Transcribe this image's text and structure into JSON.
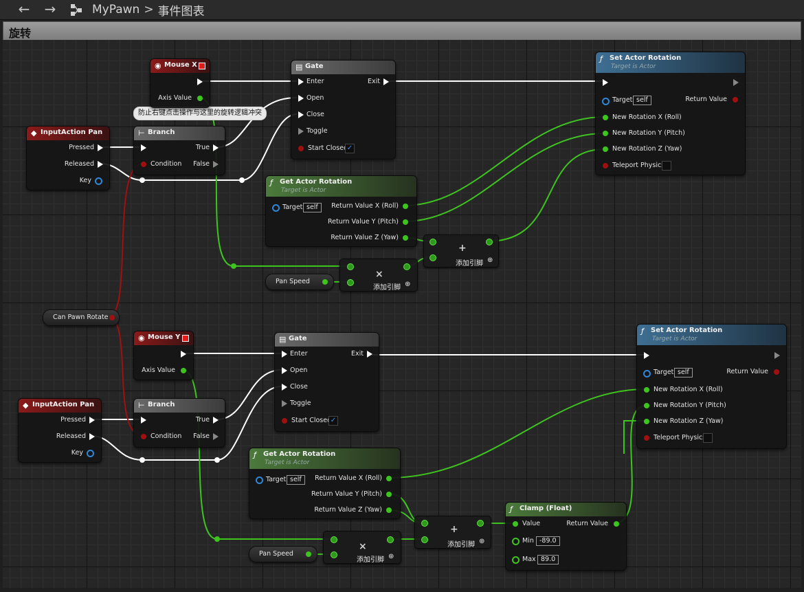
{
  "topbar": {
    "back_icon": "back-arrow-icon",
    "forward_icon": "forward-arrow-icon",
    "crumb_app": "MyPawn",
    "crumb_sep": ">",
    "crumb_page": "事件图表"
  },
  "graph_title": "旋转",
  "comment_tip": "防止右键点击操作与这里的旋转逻辑冲突",
  "mouse_x": {
    "title": "Mouse X",
    "pin": "Axis Value"
  },
  "mouse_y": {
    "title": "Mouse Y",
    "pin": "Axis Value"
  },
  "input_pan_1": {
    "title": "InputAction Pan",
    "pressed": "Pressed",
    "released": "Released",
    "key": "Key"
  },
  "input_pan_2": {
    "title": "InputAction Pan",
    "pressed": "Pressed",
    "released": "Released",
    "key": "Key"
  },
  "branch_1": {
    "title": "Branch",
    "condition": "Condition",
    "true": "True",
    "false": "False"
  },
  "branch_2": {
    "title": "Branch",
    "condition": "Condition",
    "true": "True",
    "false": "False"
  },
  "gate_1": {
    "title": "Gate",
    "enter": "Enter",
    "exit": "Exit",
    "open": "Open",
    "close": "Close",
    "toggle": "Toggle",
    "start_closed": "Start Closed",
    "start_closed_checked": true
  },
  "gate_2": {
    "title": "Gate",
    "enter": "Enter",
    "exit": "Exit",
    "open": "Open",
    "close": "Close",
    "toggle": "Toggle",
    "start_closed": "Start Closed",
    "start_closed_checked": true
  },
  "get_rot_1": {
    "title": "Get Actor Rotation",
    "subtitle": "Target is Actor",
    "target": "Target",
    "self": "self",
    "rx": "Return Value X (Roll)",
    "ry": "Return Value Y (Pitch)",
    "rz": "Return Value Z (Yaw)"
  },
  "get_rot_2": {
    "title": "Get Actor Rotation",
    "subtitle": "Target is Actor",
    "target": "Target",
    "self": "self",
    "rx": "Return Value X (Roll)",
    "ry": "Return Value Y (Pitch)",
    "rz": "Return Value Z (Yaw)"
  },
  "set_rot_1": {
    "title": "Set Actor Rotation",
    "subtitle": "Target is Actor",
    "target": "Target",
    "self": "self",
    "ret": "Return Value",
    "nx": "New Rotation X (Roll)",
    "ny": "New Rotation Y (Pitch)",
    "nz": "New Rotation Z (Yaw)",
    "tp": "Teleport Physics"
  },
  "set_rot_2": {
    "title": "Set Actor Rotation",
    "subtitle": "Target is Actor",
    "target": "Target",
    "self": "self",
    "ret": "Return Value",
    "nx": "New Rotation X (Roll)",
    "ny": "New Rotation Y (Pitch)",
    "nz": "New Rotation Z (Yaw)",
    "tp": "Teleport Physics"
  },
  "mult_1": {
    "symbol": "×",
    "add_pin": "添加引脚"
  },
  "mult_2": {
    "symbol": "×",
    "add_pin": "添加引脚"
  },
  "add_1": {
    "symbol": "+",
    "add_pin": "添加引脚"
  },
  "add_2": {
    "symbol": "+",
    "add_pin": "添加引脚"
  },
  "pan_speed_1": "Pan Speed",
  "pan_speed_2": "Pan Speed",
  "can_rotate": "Can Pawn Rotate",
  "clamp": {
    "title": "Clamp (Float)",
    "value": "Value",
    "ret": "Return Value",
    "min": "Min",
    "max": "Max",
    "min_val": "-89.0",
    "max_val": "89.0"
  },
  "colors": {
    "exec_wire": "#ffffff",
    "float_wire": "#3ec41e",
    "bool_wire": "#a01010"
  }
}
